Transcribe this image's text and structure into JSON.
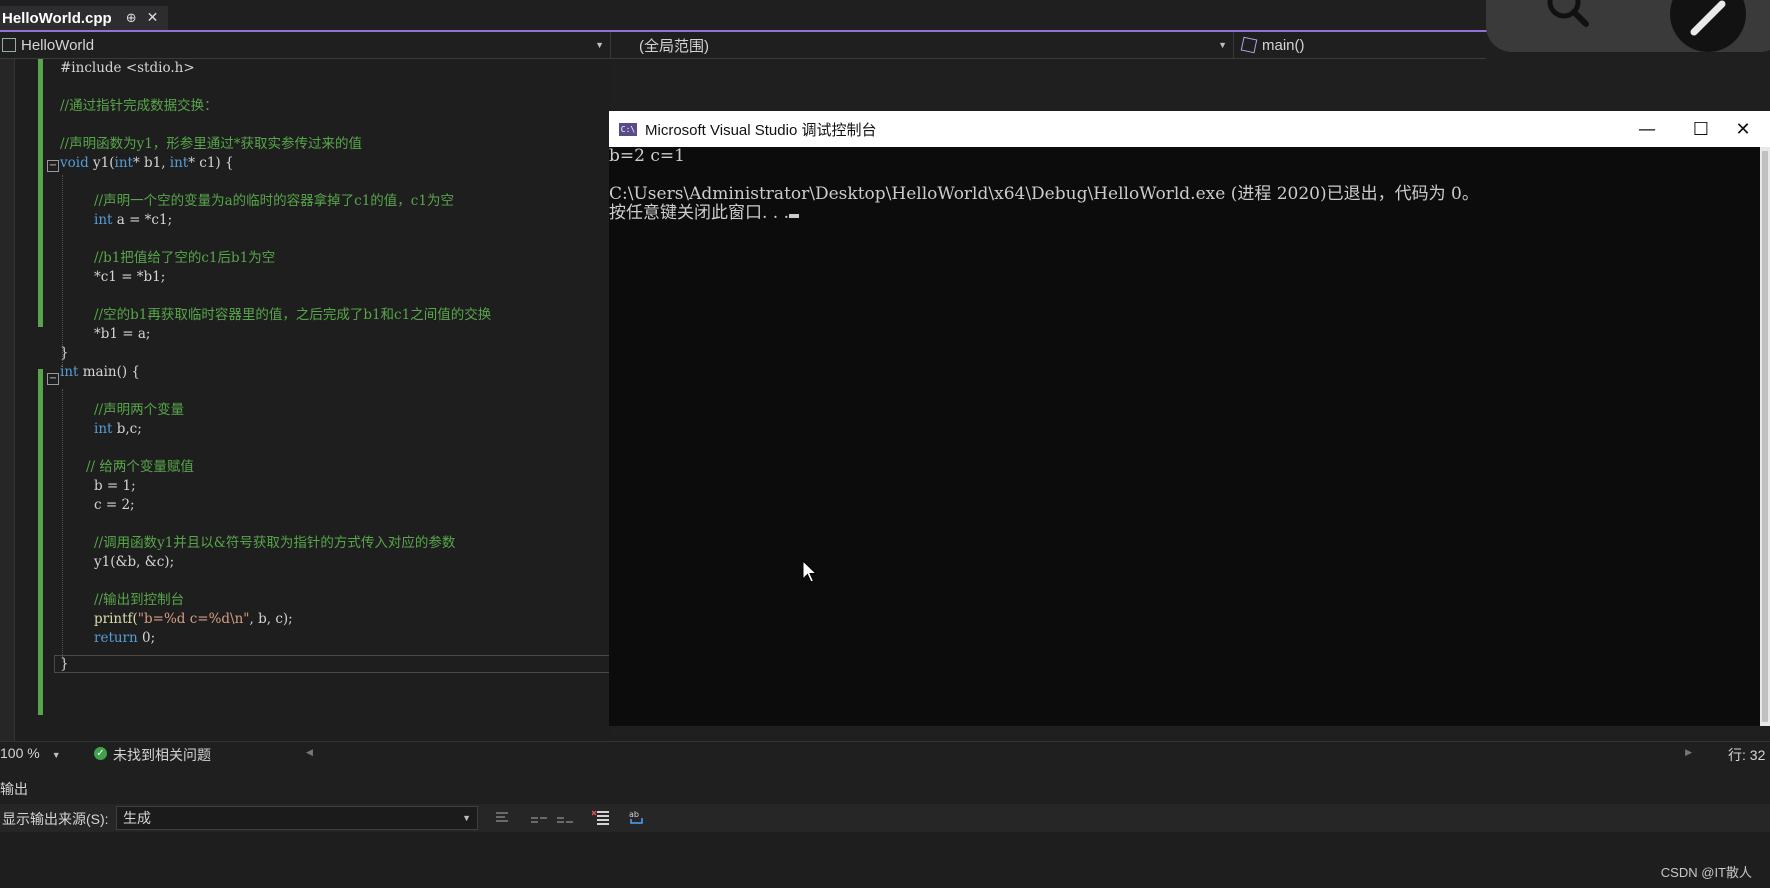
{
  "tab": {
    "filename": "HelloWorld.cpp",
    "pin_glyph": "⊕",
    "close_glyph": "✕"
  },
  "navbar": {
    "project": "HelloWorld",
    "scope": "(全局范围)",
    "member": "main()"
  },
  "code": {
    "l1": "#include <stdio.h>",
    "l2": "//通过指针完成数据交换：",
    "l3": "//声明函数为y1，形参里通过*获取实参传过来的值",
    "l4_kw1": "void",
    "l4_rest1": " y1(",
    "l4_kw2": "int",
    "l4_rest2": "* b1, ",
    "l4_kw3": "int",
    "l4_rest3": "* c1) {",
    "l5": "//声明一个空的变量为a的临时的容器拿掉了c1的值，c1为空",
    "l6_kw": "int",
    "l6_rest": " a = *c1;",
    "l7": "//b1把值给了空的c1后b1为空",
    "l8": "*c1 = *b1;",
    "l9": "//空的b1再获取临时容器里的值，之后完成了b1和c1之间值的交换",
    "l10": "*b1 = a;",
    "l11": "}",
    "l12_kw": "int",
    "l12_rest": " main() {",
    "l13": "//声明两个变量",
    "l14_kw": "int",
    "l14_rest": " b,c;",
    "l15": "// 给两个变量赋值",
    "l16": "b = 1;",
    "l17": "c = 2;",
    "l18": "//调用函数y1并且以&符号获取为指针的方式传入对应的参数",
    "l19": "y1(&b, &c);",
    "l20": "//输出到控制台",
    "l21_fn": "printf(",
    "l21_str": "\"b=%d c=%d\\n\"",
    "l21_rest": ", b, c);",
    "l22_kw": "return",
    "l22_rest": " 0;",
    "l23": "}"
  },
  "console": {
    "icon_text": "C:\\",
    "title": "Microsoft Visual Studio 调试控制台",
    "minimize": "—",
    "maximize": "☐",
    "close": "✕",
    "line1": "b=2 c=1",
    "line2": "C:\\Users\\Administrator\\Desktop\\HelloWorld\\x64\\Debug\\HelloWorld.exe (进程 2020)已退出，代码为 0。",
    "line3": "按任意键关闭此窗口. . ."
  },
  "status": {
    "zoom": "100 %",
    "issues": "未找到相关问题",
    "check_glyph": "✓",
    "line_info": "行: 32"
  },
  "output": {
    "header": "输出",
    "source_label": "显示输出来源(S):",
    "source_value": "生成"
  },
  "watermark": "CSDN @IT散人",
  "colors": {
    "accent": "#8e72d8",
    "comment": "#57a64a",
    "keyword": "#569cd6",
    "string": "#d69d85"
  }
}
